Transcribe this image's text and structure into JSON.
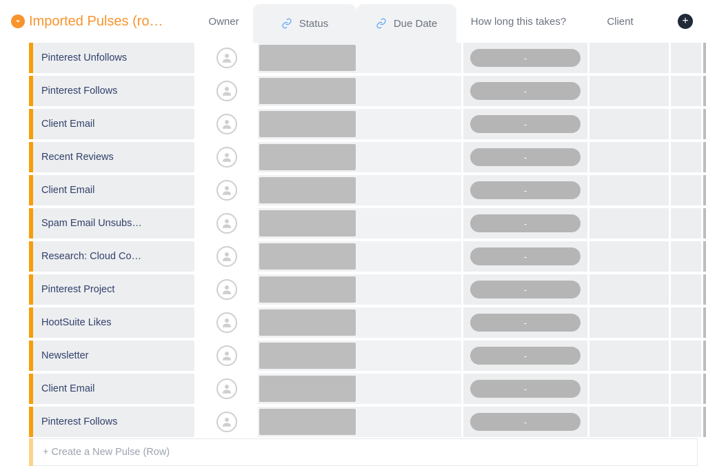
{
  "group": {
    "title": "Imported Pulses (ro…"
  },
  "columns": {
    "owner": "Owner",
    "status": "Status",
    "due_date": "Due Date",
    "how_long": "How long this takes?",
    "client": "Client"
  },
  "rows": [
    {
      "name": "Pinterest Unfollows",
      "how_long": "-"
    },
    {
      "name": "Pinterest Follows",
      "how_long": "-"
    },
    {
      "name": "Client Email",
      "how_long": "-"
    },
    {
      "name": "Recent Reviews",
      "how_long": "-"
    },
    {
      "name": "Client Email",
      "how_long": "-"
    },
    {
      "name": "Spam Email Unsubs…",
      "how_long": "-"
    },
    {
      "name": "Research: Cloud Co…",
      "how_long": "-"
    },
    {
      "name": "Pinterest Project",
      "how_long": "-"
    },
    {
      "name": "HootSuite Likes",
      "how_long": "-"
    },
    {
      "name": "Newsletter",
      "how_long": "-"
    },
    {
      "name": "Client Email",
      "how_long": "-"
    },
    {
      "name": "Pinterest Follows",
      "how_long": "-"
    }
  ],
  "new_row": {
    "placeholder": "+ Create a New Pulse (Row)"
  }
}
